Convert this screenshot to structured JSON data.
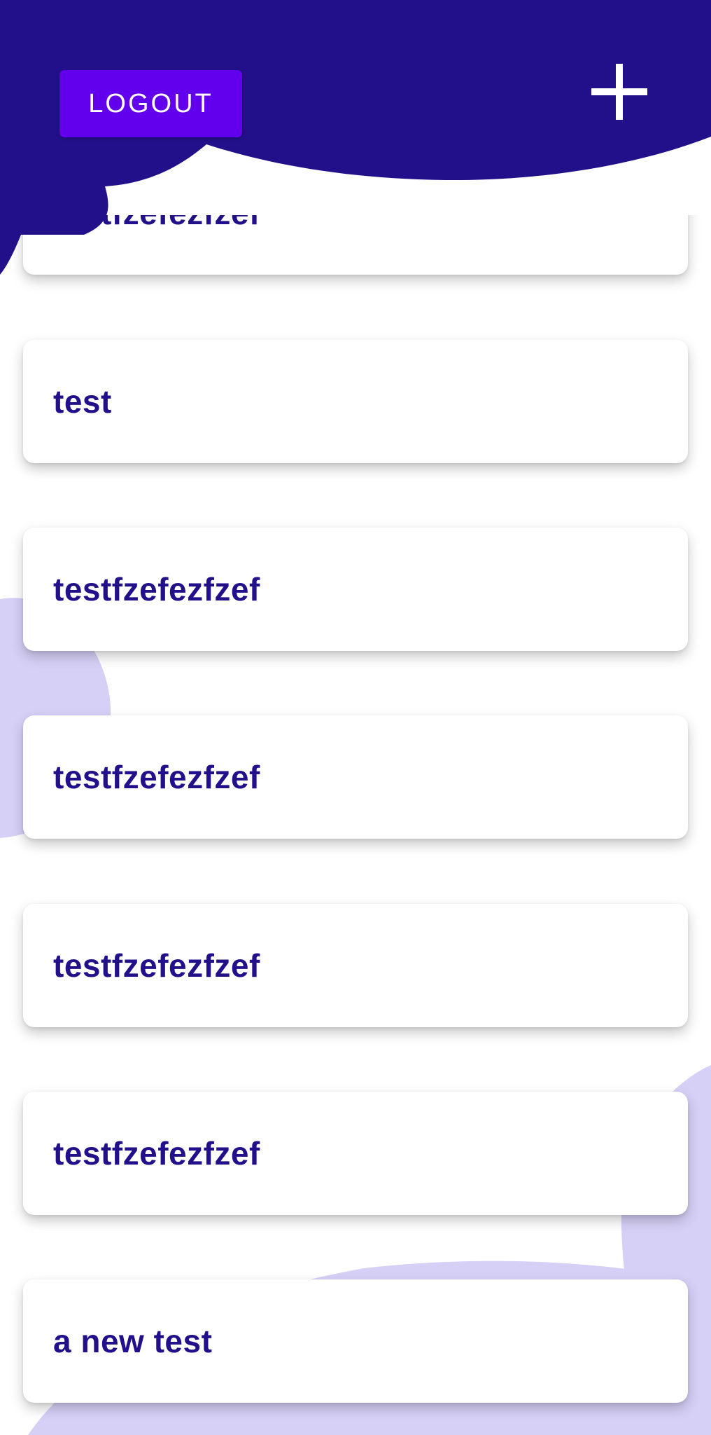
{
  "header": {
    "logout_label": "LOGOUT",
    "add_icon": "plus-icon"
  },
  "notes": [
    {
      "title": "testfzefezfzef"
    },
    {
      "title": "test"
    },
    {
      "title": "testfzefezfzef"
    },
    {
      "title": "testfzefezfzef"
    },
    {
      "title": "testfzefezfzef"
    },
    {
      "title": "testfzefezfzef"
    },
    {
      "title": "a new test"
    }
  ],
  "colors": {
    "header_bg": "#22108a",
    "button_bg": "#6200ee",
    "note_text": "#22108a",
    "blob": "#d6d0f7"
  }
}
